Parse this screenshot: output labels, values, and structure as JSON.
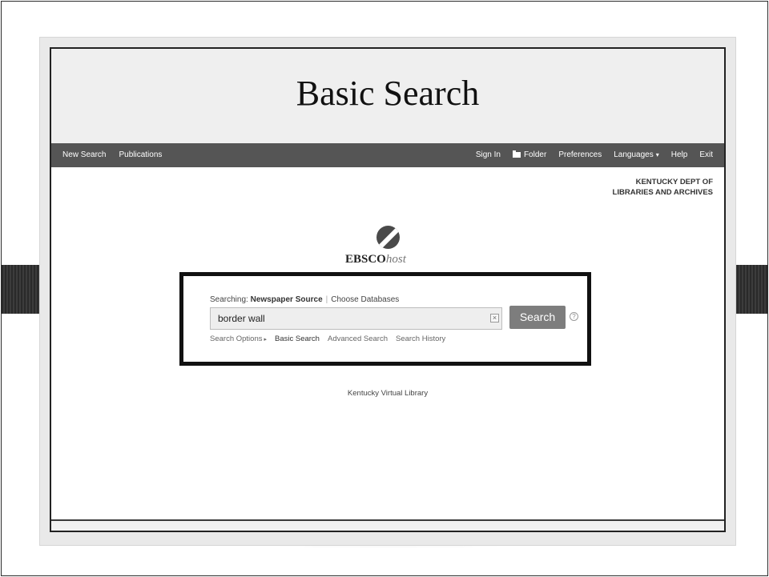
{
  "slide": {
    "title": "Basic Search"
  },
  "nav": {
    "left": [
      "New Search",
      "Publications"
    ],
    "sign_in": "Sign In",
    "folder": "Folder",
    "preferences": "Preferences",
    "languages": "Languages",
    "help": "Help",
    "exit": "Exit"
  },
  "institution": {
    "line1": "KENTUCKY DEPT OF",
    "line2": "LIBRARIES AND ARCHIVES"
  },
  "brand": {
    "bold": "EBSCO",
    "italic": "host"
  },
  "search": {
    "searching_label": "Searching:",
    "database": "Newspaper Source",
    "choose_databases": "Choose Databases",
    "query": "border wall",
    "button": "Search",
    "links": {
      "search_options": "Search Options",
      "basic_search": "Basic Search",
      "advanced_search": "Advanced Search",
      "search_history": "Search History"
    }
  },
  "footer": {
    "library": "Kentucky Virtual Library"
  }
}
